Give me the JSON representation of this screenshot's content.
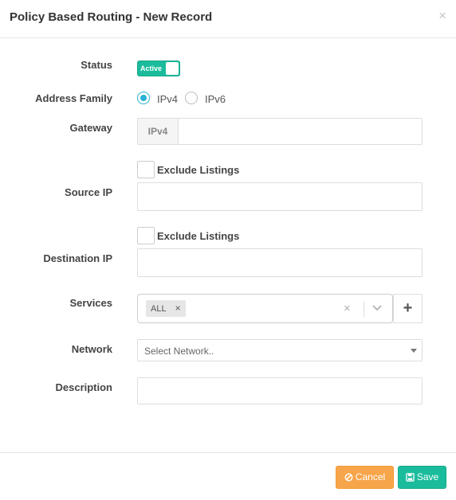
{
  "modal": {
    "title": "Policy Based Routing - New Record",
    "close": "×"
  },
  "form": {
    "status": {
      "label": "Status",
      "toggle_text": "Active",
      "on": true
    },
    "address_family": {
      "label": "Address Family",
      "options": [
        "IPv4",
        "IPv6"
      ],
      "selected": "IPv4"
    },
    "gateway": {
      "label": "Gateway",
      "addon": "IPv4",
      "value": ""
    },
    "source_ip": {
      "label": "Source IP",
      "exclude_label": "Exclude Listings",
      "value": ""
    },
    "destination_ip": {
      "label": "Destination IP",
      "exclude_label": "Exclude Listings",
      "value": ""
    },
    "services": {
      "label": "Services",
      "tags": [
        "ALL"
      ],
      "tag_remove": "×",
      "clear": "×",
      "add": "+"
    },
    "network": {
      "label": "Network",
      "placeholder": "Select Network.."
    },
    "description": {
      "label": "Description",
      "value": ""
    }
  },
  "footer": {
    "cancel_label": "Cancel",
    "save_label": "Save"
  },
  "colors": {
    "accent_green": "#1abc9c",
    "cancel_orange": "#f7a54a",
    "radio_blue": "#2bb0d6"
  },
  "icons": {
    "cancel": "ban-icon",
    "save": "floppy-icon"
  }
}
